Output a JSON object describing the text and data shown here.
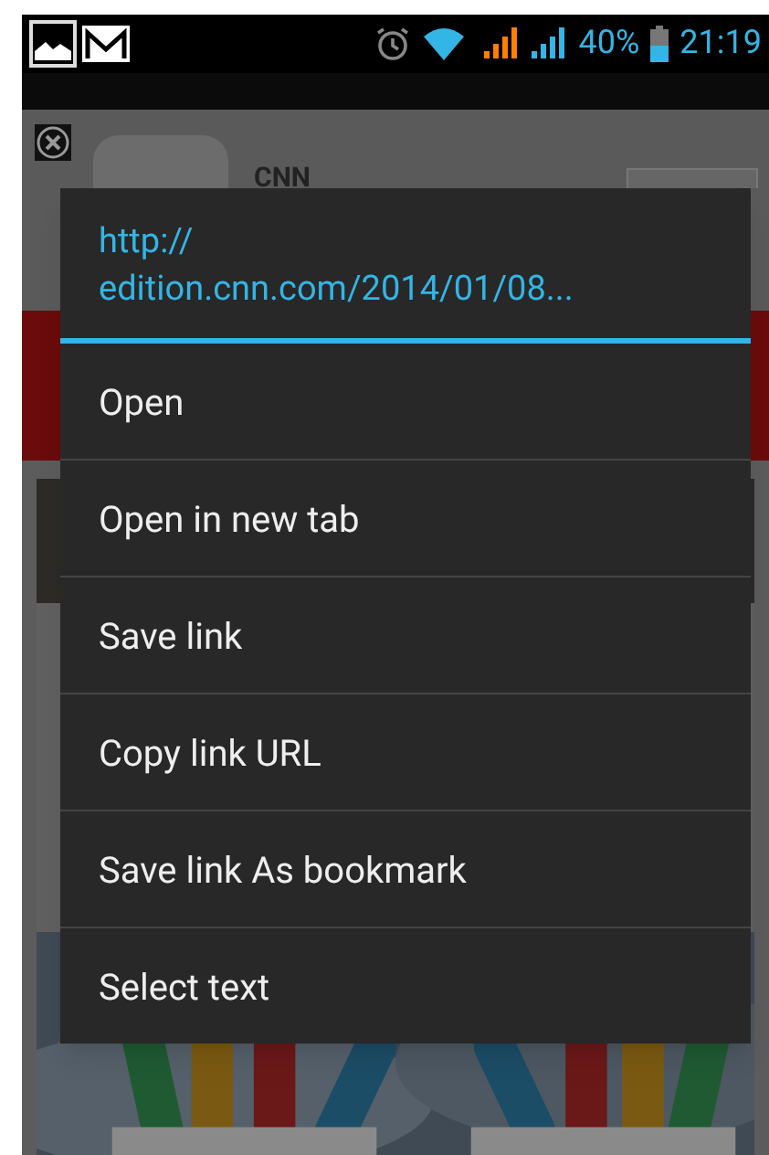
{
  "status_bar": {
    "battery": "40%",
    "time": "21:19"
  },
  "banner": {
    "app_name": "CNN"
  },
  "menu": {
    "title": "http://\nedition.cnn.com/2014/01/08...",
    "items": [
      {
        "label": "Open"
      },
      {
        "label": "Open in new tab"
      },
      {
        "label": "Save link"
      },
      {
        "label": "Copy link URL"
      },
      {
        "label": "Save link As bookmark"
      },
      {
        "label": "Select text"
      }
    ]
  }
}
